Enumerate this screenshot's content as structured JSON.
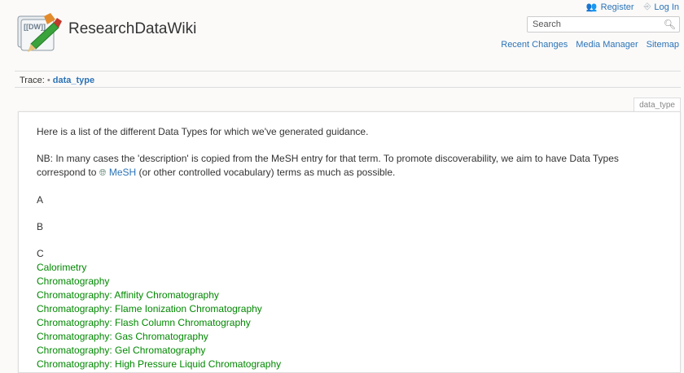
{
  "header": {
    "site_title": "ResearchDataWiki",
    "logo_text": "[[DW]]",
    "user_tools": {
      "register": "Register",
      "login": "Log In"
    },
    "search": {
      "placeholder": "Search"
    },
    "site_tools": [
      "Recent Changes",
      "Media Manager",
      "Sitemap"
    ]
  },
  "breadcrumbs": {
    "label": "Trace:",
    "separator": "•",
    "current": "data_type"
  },
  "page_id": "data_type",
  "content": {
    "intro": "Here is a list of the different Data Types for which we've generated guidance.",
    "note_before": "NB: In many cases the 'description' is copied from the MeSH entry for that term. To promote discoverability, we aim to have Data Types correspond to ",
    "note_link": "MeSH",
    "note_after": " (or other controlled vocabulary) terms as much as possible.",
    "sections": [
      {
        "letter": "A",
        "items": []
      },
      {
        "letter": "B",
        "items": []
      },
      {
        "letter": "C",
        "items": [
          "Calorimetry",
          "Chromatography",
          "Chromatography: Affinity Chromatography",
          "Chromatography: Flame Ionization Chromatography",
          "Chromatography: Flash Column Chromatography",
          "Chromatography: Gas Chromatography",
          "Chromatography: Gel Chromatography",
          "Chromatography: High Pressure Liquid Chromatography"
        ]
      }
    ]
  },
  "colors": {
    "link": "#2b73b7",
    "existing_page_link": "#008800",
    "background": "#fbfaf9"
  }
}
